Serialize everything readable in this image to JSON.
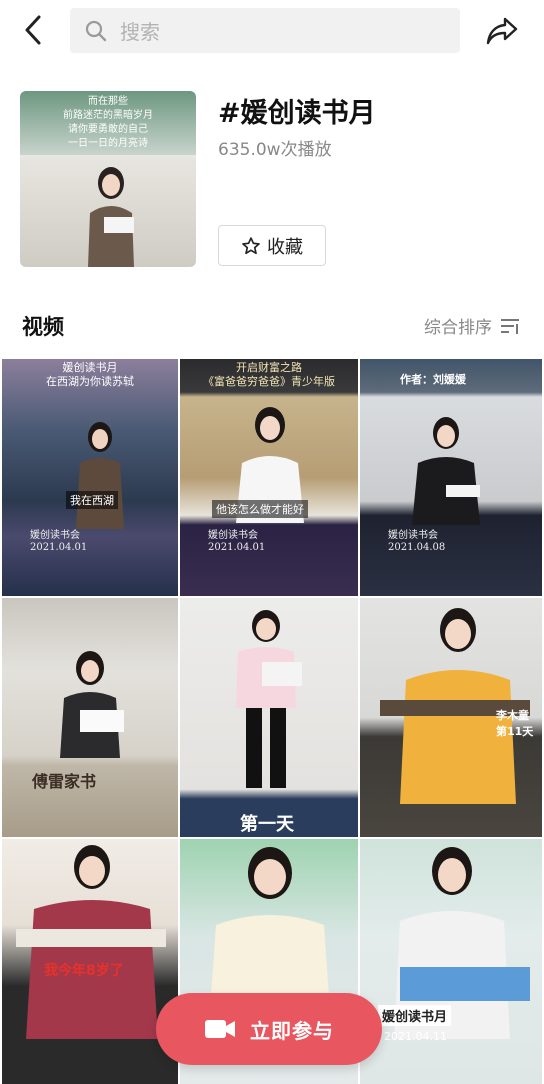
{
  "topbar": {
    "back_icon": "chevron-left-icon",
    "search_placeholder": "搜索",
    "share_icon": "share-arrow-icon"
  },
  "topic": {
    "cover_poem": [
      "而在那些",
      "前路迷茫的黑暗岁月",
      "请你要勇敢的自己",
      "一日一日的月亮诗"
    ],
    "title": "#媛创读书月",
    "plays": "635.0w次播放",
    "favorite_label": "收藏",
    "favorite_icon": "star-outline-icon"
  },
  "videos_section": {
    "title": "视频",
    "sort_label": "综合排序",
    "sort_icon": "filter-lines-icon"
  },
  "videos": [
    {
      "overlay_top": "媛创读书月\n在西湖为你读苏轼",
      "subtitle": "我在西湖",
      "footer": "媛创读书会\n2021.04.01"
    },
    {
      "overlay_top": "开启财富之路\n《富爸爸穷爸爸》青少年版",
      "subtitle": "他该怎么做才能好",
      "footer": "媛创读书会\n2021.04.01"
    },
    {
      "overlay_top": "作者：刘媛媛",
      "subtitle": "",
      "footer": "媛创读书会\n2021.04.08"
    },
    {
      "overlay_top": "",
      "subtitle": "傅雷家书",
      "footer": ""
    },
    {
      "overlay_top": "",
      "subtitle": "第一天",
      "footer": ""
    },
    {
      "overlay_top": "",
      "subtitle": "李木童\n第11天",
      "footer": ""
    },
    {
      "overlay_top": "",
      "subtitle": "我今年8岁了",
      "footer": ""
    },
    {
      "overlay_top": "",
      "subtitle": "",
      "footer": ""
    },
    {
      "overlay_top": "",
      "subtitle": "媛创读书月",
      "footer": "2021.04.11"
    }
  ],
  "cta": {
    "label": "立即参与",
    "icon": "video-camera-icon"
  },
  "colors": {
    "accent": "#e85760",
    "muted": "#888888"
  }
}
